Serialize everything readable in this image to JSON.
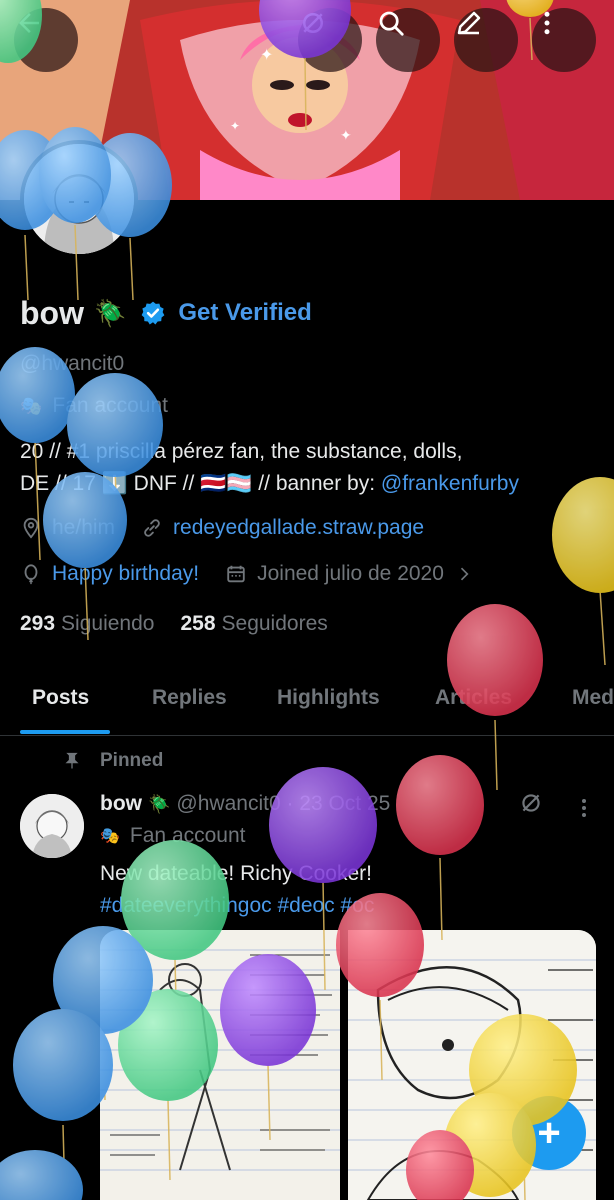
{
  "profile": {
    "name": "bow",
    "name_emoji": "🪲",
    "get_verified": "Get Verified",
    "handle": "@hwancit0",
    "category_icon": "theater-mask-icon",
    "category": "Fan account",
    "bio_line1": "20 // #1 priscilla pérez fan, the substance, dolls,",
    "bio_line2_prefix": "DE // 17 ⬇️ DNF // 🇨🇷🏳️‍⚧️ // banner by: ",
    "bio_link": "@frankenfurby",
    "pronouns": "he/him",
    "website": "redeyedgallade.straw.page",
    "birthday": "Happy birthday!",
    "joined": "Joined julio de 2020",
    "following_count": "293",
    "following_label": "Siguiendo",
    "followers_count": "258",
    "followers_label": "Seguidores"
  },
  "tabs": [
    {
      "label": "Posts",
      "active": true
    },
    {
      "label": "Replies"
    },
    {
      "label": "Highlights"
    },
    {
      "label": "Articles"
    },
    {
      "label": "Media"
    }
  ],
  "post": {
    "pinned_label": "Pinned",
    "author": "bow",
    "author_emoji": "🪲",
    "handle_date": "@hwancit0 · 23 Oct 25",
    "category": "Fan account",
    "text": "New dateable! Richy Cooker!",
    "hashtags": "#dateeverythingoc #deoc #oc"
  },
  "fab_label": "+",
  "colors": {
    "accent": "#1d9bf0",
    "link": "#4a99e9",
    "muted": "#71767b",
    "text": "#e7e9ea",
    "background": "#000000"
  },
  "icons": [
    "back-arrow-icon",
    "grok-icon",
    "search-icon",
    "edit-icon",
    "more-vertical-icon",
    "verified-badge-icon",
    "location-icon",
    "link-icon",
    "balloon-icon",
    "calendar-icon",
    "chevron-right-icon",
    "pin-icon"
  ]
}
